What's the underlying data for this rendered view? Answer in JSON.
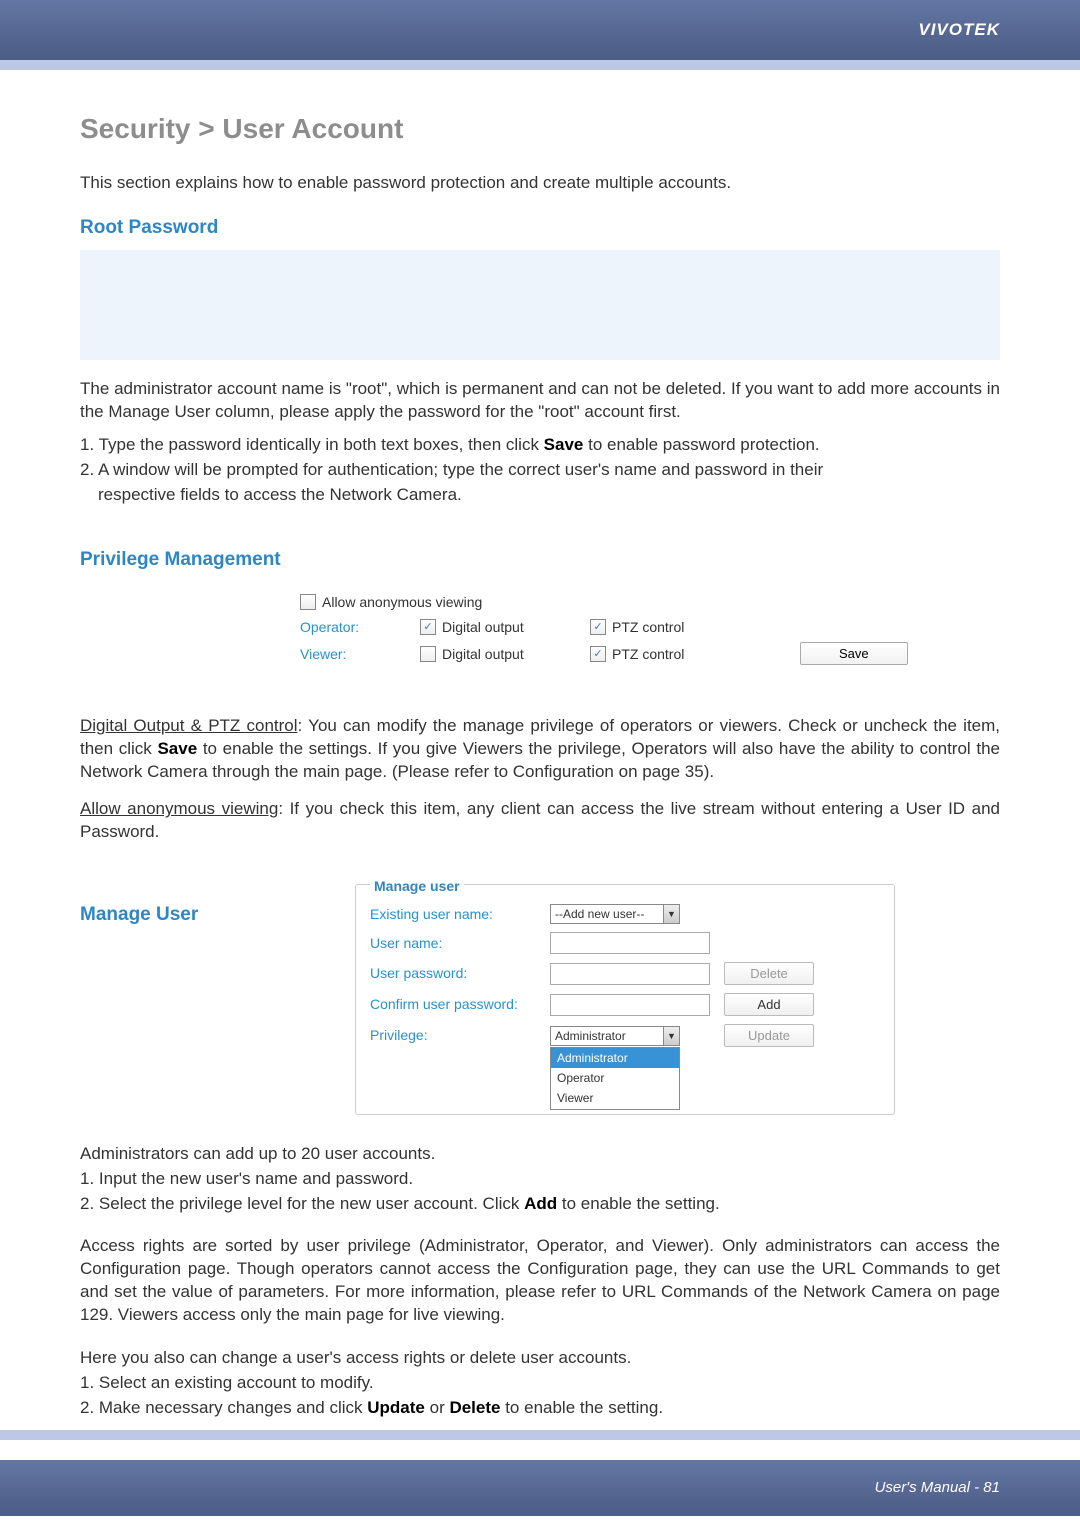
{
  "header": {
    "brand": "VIVOTEK"
  },
  "title": "Security > User Account",
  "intro": "This section explains how to enable password protection and create multiple accounts.",
  "root": {
    "heading": "Root Password",
    "p1a": "The administrator account name is \"root\", which is permanent and can not be deleted. If you want to add more accounts in the Manage User column, please apply the password for the \"root\" account first.",
    "l1a": "1. Type the password identically in both text boxes, then click ",
    "l1b": "Save",
    "l1c": " to enable password protection.",
    "l2": "2. A window will be prompted for authentication; type the correct user's name and password in their",
    "l2b": "respective fields to access the Network Camera."
  },
  "priv": {
    "heading": "Privilege Management",
    "anon_label": "Allow anonymous viewing",
    "operator": "Operator:",
    "viewer": "Viewer:",
    "digital": "Digital output",
    "ptz": "PTZ control",
    "save": "Save",
    "p1a": "Digital Output & PTZ control",
    "p1b": ": You can modify the manage privilege of operators or viewers. Check or uncheck the item, then click ",
    "p1c": "Save",
    "p1d": " to enable the settings. If you give Viewers the privilege, Operators will also have the ability to control the Network Camera through the main page. (Please refer to Configuration on page 35).",
    "p2a": "Allow anonymous viewing",
    "p2b": ": If you check this item, any client can access the live stream without entering a User ID and Password."
  },
  "manage": {
    "heading": "Manage User",
    "legend": "Manage user",
    "rows": {
      "existing": "Existing user name:",
      "uname": "User name:",
      "upass": "User password:",
      "confirm": "Confirm user password:",
      "priv": "Privilege:"
    },
    "existing_val": "--Add new user--",
    "priv_val": "Administrator",
    "opts": {
      "a": "Administrator",
      "b": "Operator",
      "c": "Viewer"
    },
    "btns": {
      "del": "Delete",
      "add": "Add",
      "upd": "Update"
    },
    "p1": "Administrators can add up to 20 user accounts.",
    "l1": "1. Input the new user's name and password.",
    "l2a": "2. Select the privilege level for the new user account. Click ",
    "l2b": "Add",
    "l2c": " to enable the setting.",
    "p2": "Access rights are sorted by user privilege (Administrator, Operator, and Viewer). Only administrators can access the Configuration page. Though operators cannot access the Configuration page, they can use the URL Commands to get and set the value of parameters. For more information, please refer to URL Commands of the Network Camera on page 129. Viewers access only the main page for live viewing.",
    "p3": "Here you also can change a user's access rights or delete user accounts.",
    "l3": "1. Select an existing account to modify.",
    "l4a": "2. Make necessary changes and click ",
    "l4b": "Update",
    "l4c": " or ",
    "l4d": "Delete",
    "l4e": " to enable the setting."
  },
  "footer": {
    "text": "User's Manual - 81"
  }
}
